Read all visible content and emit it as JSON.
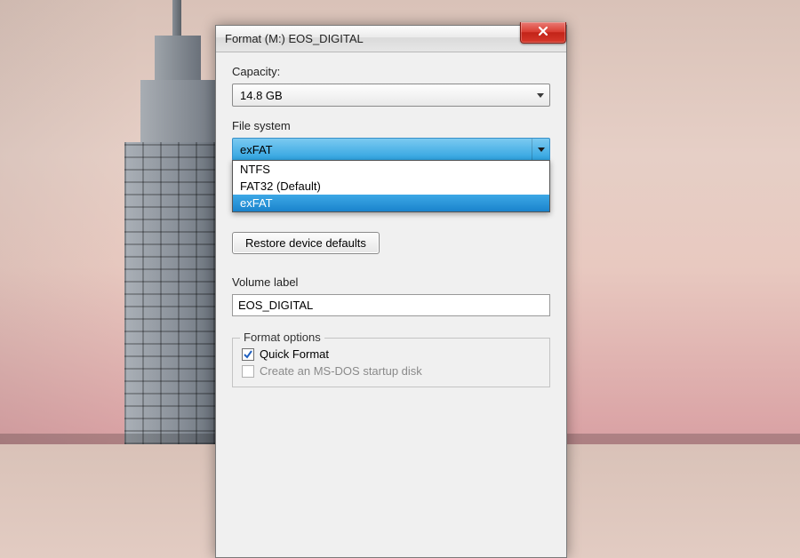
{
  "window": {
    "title": "Format (M:) EOS_DIGITAL"
  },
  "capacity": {
    "label": "Capacity:",
    "value": "14.8 GB"
  },
  "filesystem": {
    "label": "File system",
    "value": "exFAT",
    "options": [
      "NTFS",
      "FAT32 (Default)",
      "exFAT"
    ]
  },
  "restore_button": "Restore device defaults",
  "volume_label": {
    "label": "Volume label",
    "value": "EOS_DIGITAL"
  },
  "format_options": {
    "legend": "Format options",
    "quick_format": {
      "label": "Quick Format",
      "checked": true
    },
    "msdos_disk": {
      "label": "Create an MS-DOS startup disk",
      "checked": false,
      "enabled": false
    }
  },
  "icons": {
    "close": "close-icon",
    "chevron_down": "chevron-down-icon",
    "check": "check-icon"
  }
}
